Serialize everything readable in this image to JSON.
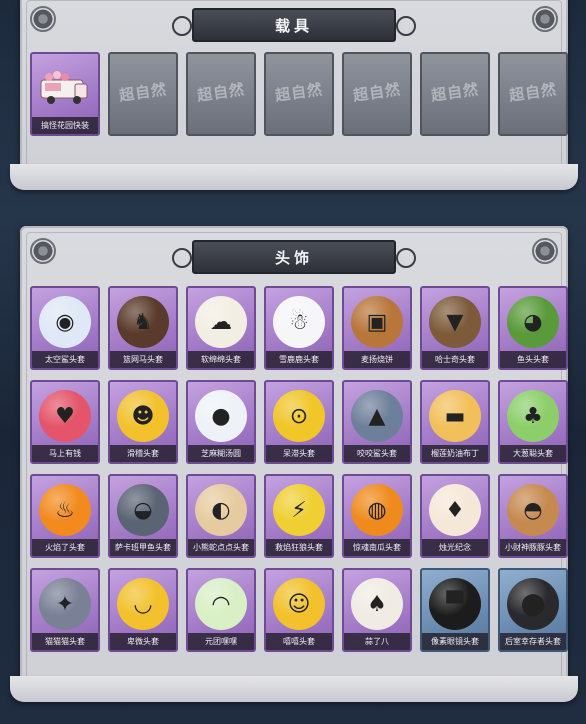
{
  "sections": {
    "vehicles": {
      "title": "载具",
      "items": [
        {
          "label": "搞怪花园快装",
          "state": "owned"
        },
        {
          "label": "",
          "state": "locked",
          "watermark": "超自然"
        },
        {
          "label": "",
          "state": "locked",
          "watermark": "超自然"
        },
        {
          "label": "",
          "state": "locked",
          "watermark": "超自然"
        },
        {
          "label": "",
          "state": "locked",
          "watermark": "超自然"
        },
        {
          "label": "",
          "state": "locked",
          "watermark": "超自然"
        },
        {
          "label": "",
          "state": "locked",
          "watermark": "超自然"
        }
      ]
    },
    "headwear": {
      "title": "头饰",
      "items": [
        {
          "label": "太空鲨头套",
          "color": "#dfe8f6",
          "icon": "shark-head-icon"
        },
        {
          "label": "篮网马头套",
          "color": "#5a3a2a",
          "icon": "horse-head-icon"
        },
        {
          "label": "软绵绵头套",
          "color": "#f3eee4",
          "icon": "cloud-head-icon"
        },
        {
          "label": "雪鹿鹿头套",
          "color": "#f6f6f8",
          "icon": "snowman-head-icon"
        },
        {
          "label": "麦扬烧饼",
          "color": "#b8763a",
          "icon": "toast-head-icon"
        },
        {
          "label": "哈士奇头套",
          "color": "#7d5b3a",
          "icon": "dog-head-icon"
        },
        {
          "label": "鱼头头套",
          "color": "#5a9a3a",
          "icon": "fish-head-icon"
        },
        {
          "label": "马上有钱",
          "color": "#e4546a",
          "icon": "pig-head-icon"
        },
        {
          "label": "滑稽头套",
          "color": "#f2c12c",
          "icon": "smile-head-icon"
        },
        {
          "label": "芝麻糊汤圆",
          "color": "#eef2f8",
          "icon": "dumpling-head-icon"
        },
        {
          "label": "呆滞头套",
          "color": "#f0c628",
          "icon": "stare-head-icon"
        },
        {
          "label": "咬咬鲨头套",
          "color": "#6d7f9a",
          "icon": "bite-shark-icon"
        },
        {
          "label": "榴莲奶油布丁",
          "color": "#f2c05a",
          "icon": "pudding-head-icon"
        },
        {
          "label": "大葱聪头套",
          "color": "#8ccf6a",
          "icon": "scallion-head-icon"
        },
        {
          "label": "火焰了头套",
          "color": "#f28a1e",
          "icon": "flame-head-icon"
        },
        {
          "label": "萨卡班甲鱼头套",
          "color": "#5b6474",
          "icon": "fish-gray-head-icon"
        },
        {
          "label": "小熊蛇点点头套",
          "color": "#e7cba0",
          "icon": "snake-head-icon"
        },
        {
          "label": "救焰狂狼头套",
          "color": "#f0cf32",
          "icon": "pika-head-icon"
        },
        {
          "label": "惊魂南瓜头套",
          "color": "#ef8a1c",
          "icon": "pumpkin-head-icon"
        },
        {
          "label": "烛光纪念",
          "color": "#f6e8d8",
          "icon": "candle-head-icon"
        },
        {
          "label": "小财神豚豚头套",
          "color": "#c68a50",
          "icon": "capybara-head-icon"
        },
        {
          "label": "猫猫猫头套",
          "color": "#7a8096",
          "icon": "cat-head-icon"
        },
        {
          "label": "卑微头套",
          "color": "#f2c12c",
          "icon": "sad-head-icon"
        },
        {
          "label": "元团嘿嘿",
          "color": "#d9f0c6",
          "icon": "rice-ball-icon"
        },
        {
          "label": "嘻嘻头套",
          "color": "#f2c12c",
          "icon": "grin-head-icon"
        },
        {
          "label": "蒜了八",
          "color": "#f0ece4",
          "icon": "garlic-head-icon"
        },
        {
          "label": "像素眼镜头套",
          "color": "#1c1c1c",
          "icon": "pixel-glasses-icon",
          "variant": "blue"
        },
        {
          "label": "后室幸存者头套",
          "color": "#2a2a2e",
          "icon": "gas-mask-icon",
          "variant": "blue"
        }
      ]
    }
  },
  "glyphs": {
    "shark-head-icon": "◉",
    "horse-head-icon": "♞",
    "cloud-head-icon": "☁",
    "snowman-head-icon": "☃",
    "toast-head-icon": "▣",
    "dog-head-icon": "▼",
    "fish-head-icon": "◕",
    "pig-head-icon": "♥",
    "smile-head-icon": "☻",
    "dumpling-head-icon": "●",
    "stare-head-icon": "⊙",
    "bite-shark-icon": "▲",
    "pudding-head-icon": "▬",
    "scallion-head-icon": "♣",
    "flame-head-icon": "♨",
    "fish-gray-head-icon": "◒",
    "snake-head-icon": "◐",
    "pika-head-icon": "⚡",
    "pumpkin-head-icon": "◍",
    "candle-head-icon": "♦",
    "capybara-head-icon": "◓",
    "cat-head-icon": "✦",
    "sad-head-icon": "◡",
    "rice-ball-icon": "◠",
    "grin-head-icon": "☺",
    "garlic-head-icon": "♠",
    "pixel-glasses-icon": "▀",
    "gas-mask-icon": "⬤"
  }
}
